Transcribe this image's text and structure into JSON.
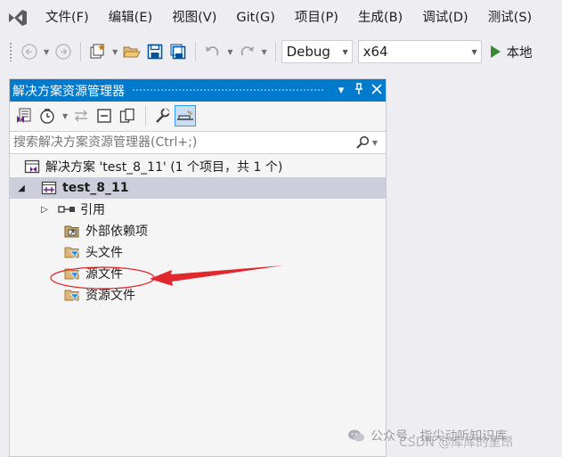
{
  "menu": {
    "items": [
      "文件(F)",
      "编辑(E)",
      "视图(V)",
      "Git(G)",
      "项目(P)",
      "生成(B)",
      "调试(D)",
      "测试(S)"
    ]
  },
  "toolbar": {
    "configuration": "Debug",
    "platform": "x64",
    "run_label": "本地"
  },
  "solution_explorer": {
    "title": "解决方案资源管理器",
    "search_placeholder": "搜索解决方案资源管理器(Ctrl+;)",
    "solution_label": "解决方案 'test_8_11' (1 个项目，共 1 个)",
    "project_label": "test_8_11",
    "items": [
      {
        "label": "引用",
        "icon": "references-icon"
      },
      {
        "label": "外部依赖项",
        "icon": "external-dependencies-icon"
      },
      {
        "label": "头文件",
        "icon": "filter-folder-icon"
      },
      {
        "label": "源文件",
        "icon": "filter-folder-icon"
      },
      {
        "label": "资源文件",
        "icon": "filter-folder-icon"
      }
    ]
  },
  "annotation": {
    "highlighted_item": "源文件",
    "color": "#e0282d"
  },
  "watermark": {
    "line1": "公众号 · 指尖动听知识库",
    "line2": "CSDN @库库的里昂"
  },
  "colors": {
    "accent": "#007acc",
    "selection": "#cccedb",
    "run_green": "#388a34"
  }
}
